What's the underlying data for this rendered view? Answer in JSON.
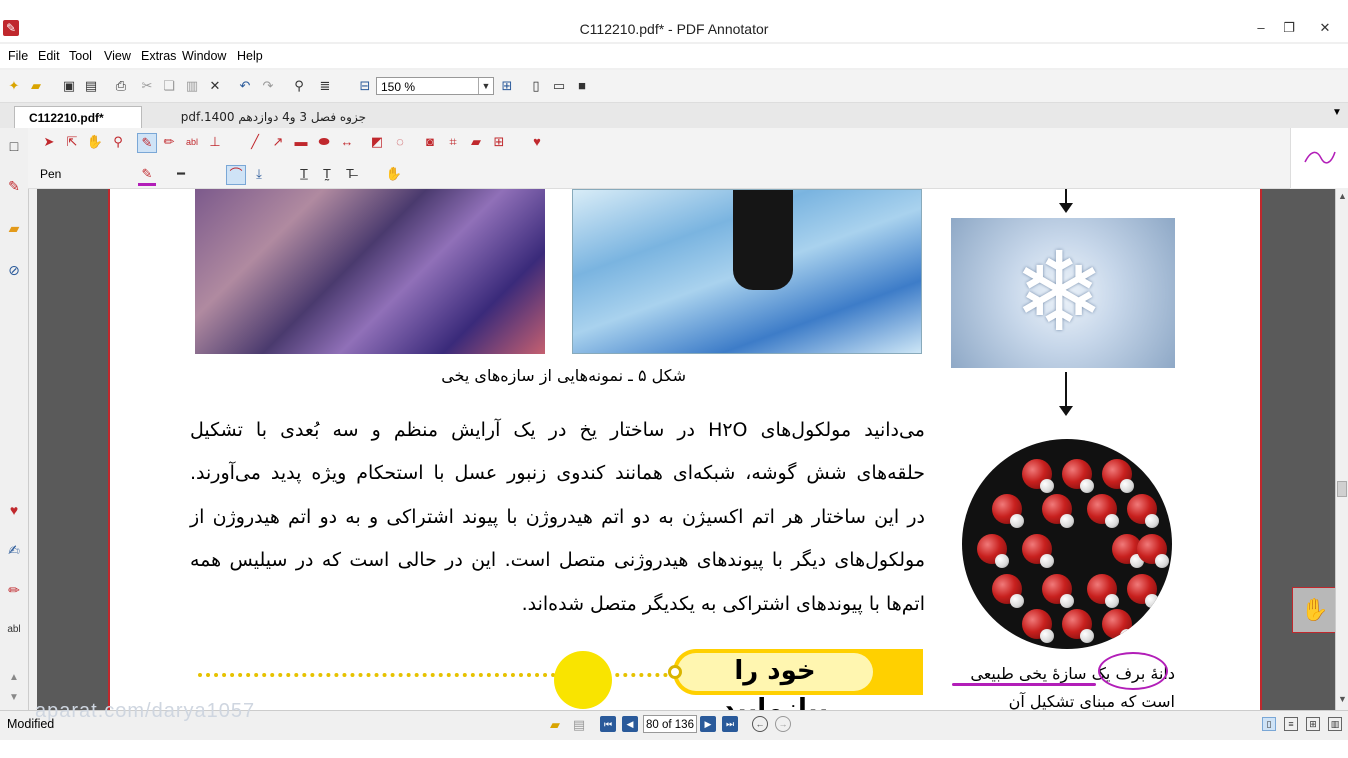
{
  "window": {
    "title": "C112210.pdf* - PDF Annotator",
    "app_icon": "pdf-annotator-icon",
    "controls": {
      "minimize": "–",
      "maximize": "❐",
      "close": "✕"
    }
  },
  "menu": {
    "file": "File",
    "edit": "Edit",
    "tool": "Tool",
    "view": "View",
    "extras": "Extras",
    "window": "Window",
    "help": "Help"
  },
  "toolbar": {
    "zoom_value": "150 %"
  },
  "tabs": [
    {
      "label": "C112210.pdf*",
      "active": true
    },
    {
      "label": "جزوه فصل 3 و4 دوازدهم 1400.pdf",
      "active": false
    }
  ],
  "tool_options": {
    "tool_name": "Pen",
    "pen_color": "#b21eb8"
  },
  "document": {
    "caption_5": "شکل ۵ ـ نمونه‌هایی از سازه‌های یخی",
    "paragraph_lines": [
      "می‌دانید مولکول‌های H۲O در ساختار یخ در یک آرایش منظم و سه بُعدی با تشکیل",
      "حلقه‌های شش گوشه، شبکه‌ای همانند کندوی زنبور عسل با استحکام ویژه پدید می‌آورند.",
      "در این ساختار هر اتم اکسیژن به دو اتم هیدروژن با پیوند اشتراکی و به دو اتم هیدروژن  از",
      "مولکول‌های دیگر با پیوندهای هیدروژنی متصل است. این در حالی است که در سیلیس همه",
      "اتم‌ها با پیوندهای اشتراکی به یکدیگر متصل شده‌اند."
    ],
    "try_it_title": "خود را بیازمایید",
    "snowflake_caption_line1": "دانهٔ برف یک سازهٔ یخی طبیعی",
    "snowflake_caption_line2": "است که مبنای تشکیل آن حلقه‌های",
    "ink_color": "#b21eb8"
  },
  "status": {
    "text": "Modified",
    "page_indicator": "80 of 136"
  },
  "watermark": "aparat.com/darya1057",
  "colors": {
    "accent": "#c0282d",
    "highlight_yellow": "#ffd000",
    "nav_blue": "#2a5a9a"
  }
}
